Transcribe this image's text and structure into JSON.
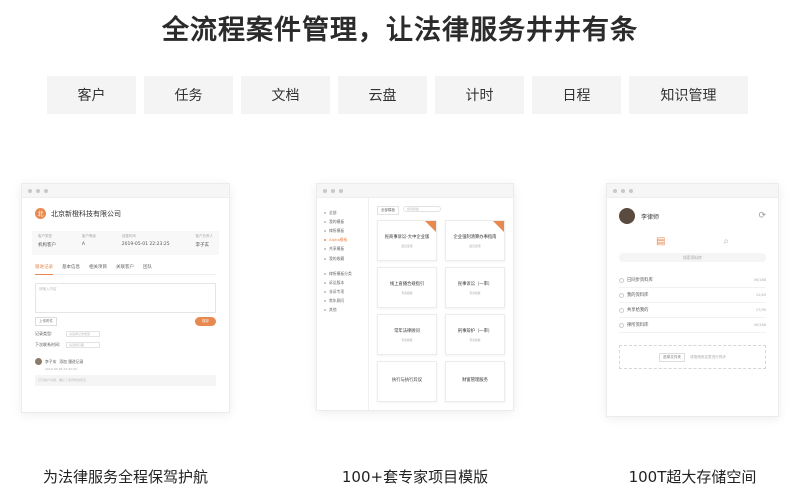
{
  "headline": "全流程案件管理，让法律服务井井有条",
  "tabs": [
    "客户",
    "任务",
    "文档",
    "云盘",
    "计时",
    "日程",
    "知识管理"
  ],
  "captions": [
    "为法律服务全程保驾护航",
    "100+套专家项目模版",
    "100T超大存储空间"
  ],
  "client_window": {
    "logo": "北",
    "company": "北京新橙科技有限公司",
    "info": [
      {
        "label": "客户类型",
        "value": "机构客户"
      },
      {
        "label": "客户等级",
        "value": "A"
      },
      {
        "label": "创建时间",
        "value": "2019-05-01 22:23:25"
      },
      {
        "label": "客户负责人",
        "value": "李子玄"
      }
    ],
    "subtabs": [
      "跟进记录",
      "基本信息",
      "相关项目",
      "关联客户",
      "团队"
    ],
    "note_placeholder": "请输入内容",
    "upload_label": "上传附件",
    "submit_label": "保存",
    "form": [
      {
        "label": "记录类型:",
        "value": "请选择记录类型"
      },
      {
        "label": "下次联系时间:",
        "value": "请选择日期"
      }
    ],
    "log_author": "李子玄",
    "log_action": "添加 跟进记录",
    "log_date": "2019-05-28 23:32:50",
    "log_text": "已与客户沟通，确认了合同修改意见"
  },
  "template_window": {
    "nav_group1": [
      "全部",
      "我的模板",
      "律所模板",
      "Alpha模板",
      "共享模板",
      "我的收藏"
    ],
    "nav_group2": [
      "律所模板分类",
      "诉讼版本",
      "非诉专项",
      "常年顾问",
      "其他"
    ],
    "filter": "全部模板",
    "search_placeholder": "搜索模板",
    "cards": [
      {
        "title": "民商事诉讼-大中企业版",
        "sub": "最近使用",
        "ribbon": true
      },
      {
        "title": "企业强制清算办事指南",
        "sub": "最近使用",
        "ribbon": true
      },
      {
        "title": "线上直播合规指引",
        "sub": "专家模板",
        "ribbon": false
      },
      {
        "title": "民事诉讼（一审）",
        "sub": "专家模板",
        "ribbon": false
      },
      {
        "title": "常年法律顾问",
        "sub": "专家模板",
        "ribbon": false
      },
      {
        "title": "刑事辩护（一审）",
        "sub": "专家模板",
        "ribbon": false
      },
      {
        "title": "执行与执行异议",
        "sub": "",
        "ribbon": false
      },
      {
        "title": "财富管理服务",
        "sub": "",
        "ribbon": false
      }
    ]
  },
  "storage_window": {
    "name": "李律师",
    "search_placeholder": "搜索资料库",
    "folders": [
      {
        "name": "已同步资料库",
        "count": "56/168"
      },
      {
        "name": "我的资料库",
        "count": "12/40"
      },
      {
        "name": "共享给我的",
        "count": "17/35"
      },
      {
        "name": "律所资料库",
        "count": "40/166"
      }
    ],
    "upload_btn": "选择文件夹",
    "upload_hint": "或拖拽到这里进行同步"
  },
  "colors": {
    "accent": "#e88a4f"
  }
}
